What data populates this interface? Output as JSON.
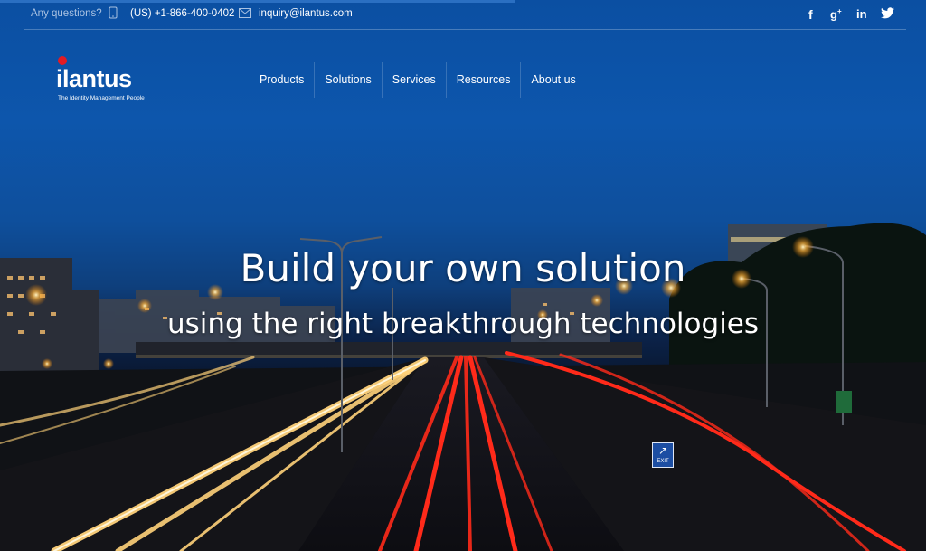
{
  "topbar": {
    "question": "Any questions?",
    "phone": "(US) +1-866-400-0402",
    "email": "inquiry@ilantus.com",
    "social": [
      "f",
      "g+",
      "in",
      "twitter"
    ]
  },
  "logo": {
    "wordmark": "ilantus",
    "tagline": "The Identity Management People"
  },
  "nav": {
    "items": [
      "Products",
      "Solutions",
      "Services",
      "Resources",
      "About us"
    ]
  },
  "hero": {
    "headline": "Build your own solution",
    "subheadline": "using the right breakthrough technologies",
    "sign_text": "EXIT"
  },
  "colors": {
    "brand_red": "#e21b24",
    "sky_blue": "#0d56ac"
  }
}
